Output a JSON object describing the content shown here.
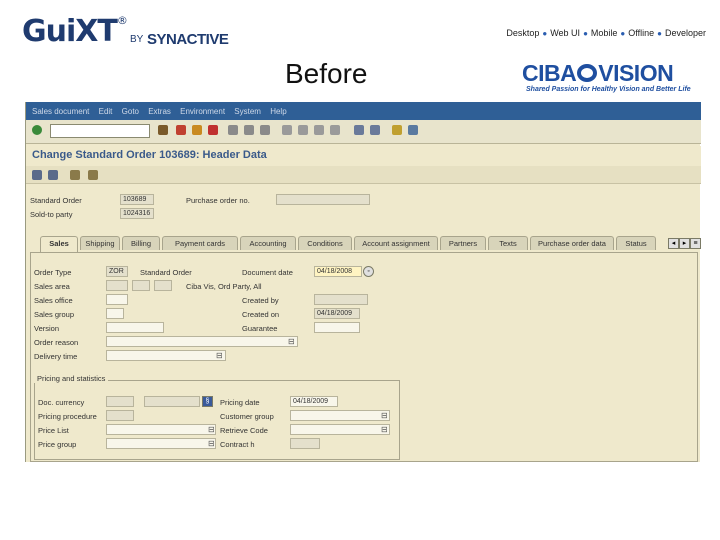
{
  "header": {
    "logo_text": "GuiXT",
    "logo_reg": "®",
    "logo_by": "BY",
    "logo_company": "SYNACTIVE",
    "nav": [
      "Desktop",
      "Web UI",
      "Mobile",
      "Offline",
      "Developer"
    ],
    "caption": "Before",
    "client_logo_left": "CIBA",
    "client_logo_right": "VISION",
    "client_tagline": "Shared Passion for Healthy Vision and Better Life"
  },
  "sap": {
    "menu": [
      "Sales document",
      "Edit",
      "Goto",
      "Extras",
      "Environment",
      "System",
      "Help"
    ],
    "title": "Change Standard Order 103689: Header Data",
    "standard_order_label": "Standard Order",
    "standard_order_value": "103689",
    "sold_to_label": "Sold-to party",
    "sold_to_value": "1024316",
    "po_label": "Purchase order no.",
    "tabs": [
      "Sales",
      "Shipping",
      "Billing",
      "Payment cards",
      "Accounting",
      "Conditions",
      "Account assignment",
      "Partners",
      "Texts",
      "Purchase order data",
      "Status"
    ],
    "fields_left": [
      {
        "label": "Order Type",
        "value": "ZOR",
        "extra": "Standard Order"
      },
      {
        "label": "Sales area",
        "value": "",
        "extra": "Ciba Vis, Ord Party, All"
      },
      {
        "label": "Sales office",
        "value": ""
      },
      {
        "label": "Sales group",
        "value": ""
      },
      {
        "label": "Version",
        "value": ""
      },
      {
        "label": "Order reason",
        "value": ""
      },
      {
        "label": "Delivery time",
        "value": ""
      }
    ],
    "fields_right": [
      {
        "label": "Document date",
        "value": "04/18/2008"
      },
      {
        "label": "Created by",
        "value": ""
      },
      {
        "label": "Created on",
        "value": "04/18/2009"
      },
      {
        "label": "Guarantee",
        "value": ""
      }
    ],
    "pricing_group": {
      "title": "Pricing and statistics",
      "rows_left": [
        {
          "label": "Doc. currency",
          "value": ""
        },
        {
          "label": "Pricing procedure",
          "value": ""
        },
        {
          "label": "Price List",
          "value": ""
        },
        {
          "label": "Price group",
          "value": ""
        }
      ],
      "rows_right": [
        {
          "label": "Pricing date",
          "value": "04/18/2009"
        },
        {
          "label": "Customer group",
          "value": ""
        },
        {
          "label": "Retrieve Code",
          "value": ""
        },
        {
          "label": "Contract h",
          "value": ""
        }
      ]
    }
  }
}
